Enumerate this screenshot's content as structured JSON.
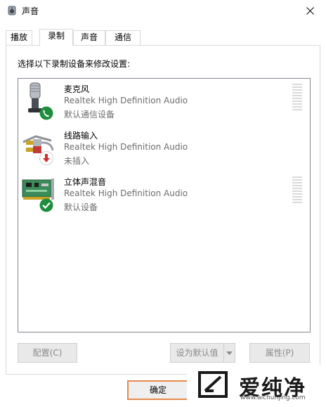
{
  "window": {
    "title": "声音"
  },
  "tabs": [
    {
      "label": "播放",
      "active": false
    },
    {
      "label": "录制",
      "active": true
    },
    {
      "label": "声音",
      "active": false
    },
    {
      "label": "通信",
      "active": false
    }
  ],
  "instruction": "选择以下录制设备来修改设置:",
  "devices": [
    {
      "name": "麦克风",
      "description": "Realtek High Definition Audio",
      "status": "默认通信设备",
      "icon": "microphone-icon",
      "badge": "phone-badge-icon"
    },
    {
      "name": "线路输入",
      "description": "Realtek High Definition Audio",
      "status": "未插入",
      "icon": "line-in-icon",
      "badge": "unplugged-badge-icon"
    },
    {
      "name": "立体声混音",
      "description": "Realtek High Definition Audio",
      "status": "默认设备",
      "icon": "sound-card-icon",
      "badge": "check-badge-icon"
    }
  ],
  "buttons": {
    "configure": "配置(C)",
    "set_default": "设为默认值(S)",
    "properties": "属性(P)",
    "ok": "确定"
  },
  "watermark": {
    "text": "爱纯净",
    "url": "www.aichunjing.com"
  },
  "colors": {
    "badge_green": "#1e8e3e",
    "badge_red": "#d32f2f",
    "ok_border": "#e58a4a",
    "disabled_text": "#8a8a8a"
  }
}
